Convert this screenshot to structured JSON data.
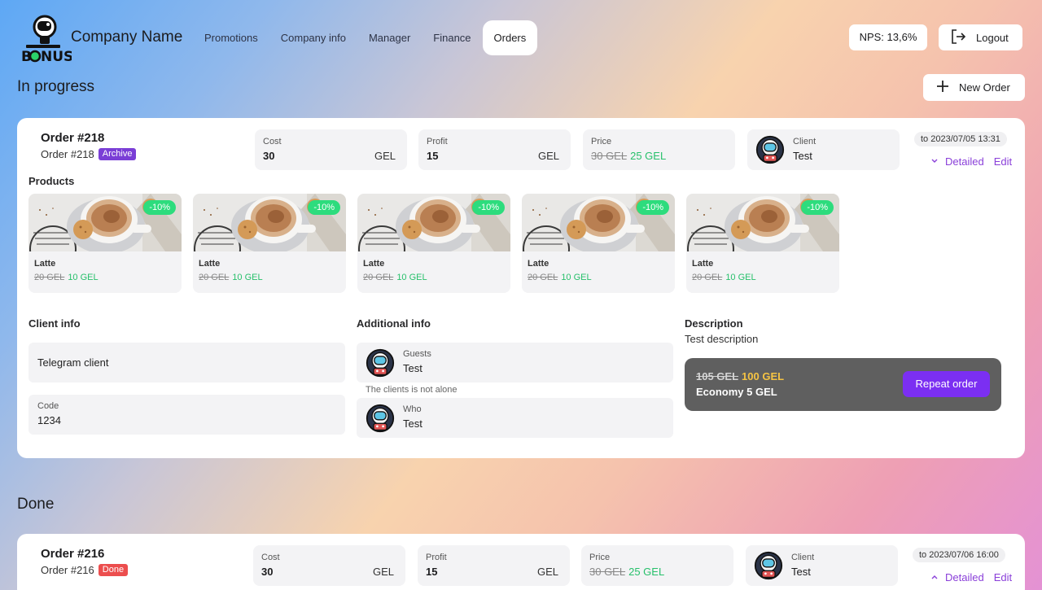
{
  "header": {
    "logo_text": "SPACE BONUS",
    "company_name": "Company Name",
    "nav": [
      "Promotions",
      "Company info",
      "Manager",
      "Finance",
      "Orders"
    ],
    "nps": "NPS: 13,6%",
    "logout": "Logout"
  },
  "sections": {
    "in_progress": "In progress",
    "done": "Done"
  },
  "new_order_label": "New Order",
  "order1": {
    "title": "Order #218",
    "subtitle": "Order #218",
    "badge": "Archive",
    "cost_label": "Cost",
    "cost_value": "30",
    "cost_unit": "GEL",
    "profit_label": "Profit",
    "profit_value": "15",
    "profit_unit": "GEL",
    "price_label": "Price",
    "price_old": "30 GEL",
    "price_new": "25 GEL",
    "client_label": "Client",
    "client_value": "Test",
    "date": "to 2023/07/05 13:31",
    "detailed": "Detailed",
    "edit": "Edit",
    "products_label": "Products",
    "products": [
      {
        "name": "Latte",
        "old": "20 GEL",
        "new": "10 GEL",
        "discount": "-10%"
      },
      {
        "name": "Latte",
        "old": "20 GEL",
        "new": "10 GEL",
        "discount": "-10%"
      },
      {
        "name": "Latte",
        "old": "20 GEL",
        "new": "10 GEL",
        "discount": "-10%"
      },
      {
        "name": "Latte",
        "old": "20 GEL",
        "new": "10 GEL",
        "discount": "-10%"
      },
      {
        "name": "Latte",
        "old": "20 GEL",
        "new": "10 GEL",
        "discount": "-10%"
      }
    ],
    "client_info_label": "Client info",
    "client_source": "Telegram client",
    "code_label": "Code",
    "code_value": "1234",
    "additional_label": "Additional info",
    "guests_label": "Guests",
    "guests_value": "Test",
    "clients_note": "The clients is not alone",
    "who_label": "Who",
    "who_value": "Test",
    "description_label": "Description",
    "description_value": "Test description",
    "total_old": "105 GEL",
    "total_new": "100 GEL",
    "economy": "Economy 5 GEL",
    "repeat": "Repeat order"
  },
  "order2": {
    "title": "Order #216",
    "subtitle": "Order #216",
    "badge": "Done",
    "cost_label": "Cost",
    "cost_value": "30",
    "cost_unit": "GEL",
    "profit_label": "Profit",
    "profit_value": "15",
    "profit_unit": "GEL",
    "price_label": "Price",
    "price_old": "30 GEL",
    "price_new": "25 GEL",
    "client_label": "Client",
    "client_value": "Test",
    "date": "to 2023/07/06 16:00",
    "detailed": "Detailed",
    "edit": "Edit"
  },
  "colors": {
    "accent": "#7b2ff2",
    "link": "#8a3fd9",
    "discount_green": "#2ddc7d",
    "price_green": "#27c06b",
    "archive_badge": "#7a3ed6",
    "done_badge": "#ec4e4e",
    "total_gold": "#f5c343"
  },
  "icons": [
    "astronaut-logo",
    "logout-icon",
    "plus-icon",
    "chevron-down-icon",
    "chevron-up-icon",
    "astronaut-avatar"
  ]
}
